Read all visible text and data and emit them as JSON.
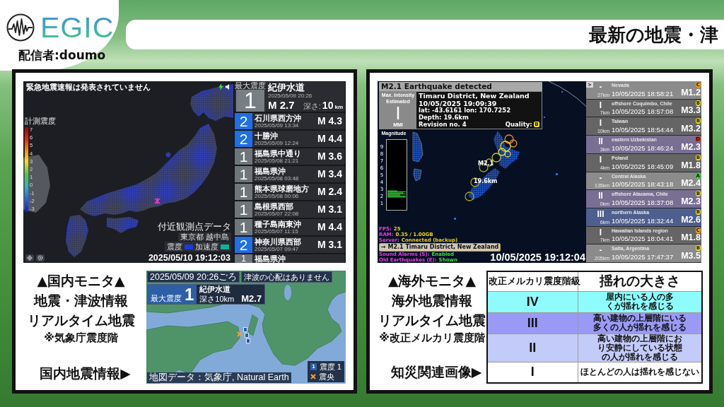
{
  "header": {
    "logo": "EGIC",
    "streamer": "配信者:doumo",
    "title": "最新の地震・津"
  },
  "domestic_panel": {
    "monitor": {
      "eew_status": "緊急地震速報は発表されていません",
      "intensity_scale": {
        "label": "計測震度",
        "ticks": [
          "7",
          "6",
          "5",
          "4",
          "3",
          "2",
          "1",
          "0",
          "-1",
          "-2",
          "-3"
        ]
      },
      "station": {
        "heading": "付近観測点データ",
        "name": "東京都 越中島",
        "legend": [
          {
            "label": "震度",
            "color": "#1a3ae0"
          },
          {
            "label": "加速度",
            "color": "#12b09a"
          }
        ]
      },
      "timestamp": "2025/05/10 19:12:03",
      "latest": {
        "label": "最大震度",
        "intensity": "1",
        "color": "#787f84",
        "place": "紀伊水道",
        "time": "2025/05/09 20:26",
        "magnitude": "M 2.7",
        "depth_label": "深さ:",
        "depth": "10",
        "depth_unit": "km"
      },
      "events": [
        {
          "intensity": "2",
          "color": "#1f6fe6",
          "place": "石川県西方沖",
          "time": "2025/05/09 13:34",
          "magnitude": "M 4.3"
        },
        {
          "intensity": "2",
          "color": "#1f6fe6",
          "place": "十勝沖",
          "time": "2025/05/09 12:24",
          "magnitude": "M 4.4"
        },
        {
          "intensity": "1",
          "color": "#6e767b",
          "place": "福島県中通り",
          "time": "2025/05/08 21:21",
          "magnitude": "M 3.6"
        },
        {
          "intensity": "1",
          "color": "#6e767b",
          "place": "福島県沖",
          "time": "2025/05/08 03:48",
          "magnitude": "M 3.4"
        },
        {
          "intensity": "1",
          "color": "#6e767b",
          "place": "熊本県球磨地方",
          "time": "2025/05/08 00:06",
          "magnitude": "M 2.4"
        },
        {
          "intensity": "1",
          "color": "#6e767b",
          "place": "島根県西部",
          "time": "2025/05/07 22:08",
          "magnitude": "M 3.1"
        },
        {
          "intensity": "1",
          "color": "#6e767b",
          "place": "種子島南東沖",
          "time": "2025/05/07 11:15",
          "magnitude": "M 4.4"
        },
        {
          "intensity": "2",
          "color": "#1f6fe6",
          "place": "神奈川県西部",
          "time": "2025/05/07 09:47",
          "magnitude": "M 3.1"
        },
        {
          "intensity": "1",
          "color": "#6e767b",
          "place": "福島県沖"
        }
      ]
    },
    "captions": [
      {
        "kind": "heading",
        "text": "▲国内モニタ▲"
      },
      {
        "kind": "heading",
        "text": "地震・津波情報"
      },
      {
        "kind": "heading",
        "text": "リアルタイム地震"
      },
      {
        "kind": "note",
        "text": "※気象庁震度階"
      }
    ],
    "pointer": "国内地震情報▶",
    "info_map": {
      "time": "2025/05/09 20:26ごろ",
      "tsunami": "津波の心配はありません",
      "label": "最大震度",
      "intensity": "1",
      "color": "#2d5fa6",
      "place": "紀伊水道",
      "depth": "深さ10km",
      "magnitude": "M2.7",
      "legend": [
        {
          "kind": "intensity",
          "mark": "1",
          "label": "震度 1",
          "color": "#2d5fa6"
        },
        {
          "kind": "epicenter",
          "label": "震央"
        }
      ],
      "attribution": "地図データ：気象庁, Natural Earth"
    }
  },
  "overseas_panel": {
    "monitor": {
      "alert": {
        "title": "M2.1 Earthquake detected",
        "intensity_label": "Max. Intensity",
        "intensity_note": "Estimated",
        "intensity": "I",
        "scale": "MMI",
        "place": "Timaru District, New Zealand",
        "time": "10/05/2025 19:09:39",
        "coordinates": "lat: -43.6161 lon: 170.7252",
        "depth": "Depth: 19.6km",
        "revision": "Revision no. 4",
        "quality_label": "Quality:",
        "quality": {
          "grade": "B",
          "color": "#f2e41c"
        }
      },
      "magnitude_meter": {
        "label": "Magnitude",
        "ticks": [
          "9",
          "8",
          "7",
          "6",
          "5",
          "4",
          "3",
          "2",
          "1"
        ]
      },
      "map_labels": {
        "magnitude": "M2.1",
        "depth": "19.6km"
      },
      "status": [
        {
          "label": "FPS:",
          "value": "25",
          "color": "#e8d41c"
        },
        {
          "label": "RAM:",
          "value": "0.35 / 1.00GB",
          "color": "#e8d41c"
        },
        {
          "label": "Server:",
          "value": "Connected (backup)",
          "color": "#e8d41c"
        }
      ],
      "selected_event": "→ M2.1 Timaru District, New Zealand",
      "toggles": [
        {
          "label": "Sound Alarms (S):",
          "value": "Enabled",
          "color": "#3ce03c"
        },
        {
          "label": "Old Earthquakes (E):",
          "value": "Shown",
          "color": "#3ce03c"
        }
      ],
      "timestamp": "10/05/2025 19:12:04",
      "list_toggle": ">",
      "events": [
        {
          "intensity": "-",
          "depth": "27km",
          "place": "Nevada",
          "time": "10/05/2025 18:58:21",
          "magnitude": "M1.2",
          "color": "#8b8b8b",
          "quality": {
            "grade": "C",
            "color": "#f0a01c"
          }
        },
        {
          "intensity": "I",
          "depth": "7km",
          "place": "offshore Coquimbo, Chile",
          "time": "10/05/2025 18:57:08",
          "magnitude": "M3.3",
          "color": "#656565",
          "quality": {
            "grade": "B",
            "color": "#f2e41c"
          }
        },
        {
          "intensity": "I",
          "depth": "10km",
          "place": "Taiwan",
          "time": "10/05/2025 18:54:44",
          "magnitude": "M3.2",
          "color": "#656565",
          "quality": {
            "grade": "B",
            "color": "#f2e41c"
          }
        },
        {
          "intensity": "II",
          "depth": "3km",
          "place": "eastern Uzbekistan",
          "time": "10/05/2025 18:46:24",
          "magnitude": "M2.3",
          "color": "#786f92",
          "quality": {
            "grade": "D",
            "color": "#e0361c"
          }
        },
        {
          "intensity": "I",
          "depth": "4km",
          "place": "Poland",
          "time": "10/05/2025 18:45:09",
          "magnitude": "M1.8",
          "color": "#656565",
          "quality": {
            "grade": "B",
            "color": "#f2e41c"
          }
        },
        {
          "intensity": "-",
          "depth": "135km",
          "place": "Central Alaska",
          "time": "10/05/2025 18:43:18",
          "magnitude": "M2.4",
          "color": "#8b8b8b",
          "quality": {
            "grade": "A",
            "color": "#2ee02e"
          }
        },
        {
          "intensity": "II",
          "depth": "0km",
          "place": "offshore Atacama, Chile",
          "time": "10/05/2025 18:37:08",
          "magnitude": "M2.3",
          "color": "#786f92",
          "quality": {
            "grade": "B",
            "color": "#f2e41c"
          }
        },
        {
          "intensity": "III",
          "depth": "6km",
          "place": "northern Alaska",
          "time": "10/05/2025 18:32:44",
          "magnitude": "M2.6",
          "color": "#4e5e8e",
          "quality": {
            "grade": "B",
            "color": "#f2e41c"
          }
        },
        {
          "intensity": "I",
          "depth": "7km",
          "place": "Hawaiian Islands region",
          "time": "10/05/2025 18:04:41",
          "magnitude": "M1.8",
          "color": "#656565",
          "quality": {
            "grade": "C",
            "color": "#f0a01c"
          }
        },
        {
          "intensity": "-",
          "depth": "205km",
          "place": "Salta, Argentina",
          "time": "10/05/2025 17:47:37",
          "magnitude": "M3.5",
          "color": "#8b8b8b",
          "quality": {
            "grade": "B",
            "color": "#f2e41c"
          }
        }
      ]
    },
    "captions": [
      {
        "kind": "heading",
        "text": "▲海外モニタ▲"
      },
      {
        "kind": "heading",
        "text": "海外地震情報"
      },
      {
        "kind": "heading",
        "text": "リアルタイム地震"
      },
      {
        "kind": "note",
        "text": "※改正メルカリ震度階"
      }
    ],
    "pointer": "知災関連画像▶",
    "mmi_table": {
      "columns": [
        "改正メルカリ震度階級",
        "揺れの大きさ"
      ],
      "rows": [
        {
          "grade": "IV",
          "description": "屋内にいる人の多くが揺れを感じる",
          "color": "#8efcfc"
        },
        {
          "grade": "III",
          "description": "高い建物の上層階にいる多くの人が揺れを感じる",
          "color": "#9a9af6"
        },
        {
          "grade": "II",
          "description": "高い建物の上層階におり安静にしている状態の人が揺れを感じる",
          "color": "#c3cbf9"
        },
        {
          "grade": "I",
          "description": "ほとんどの人は揺れを感じない",
          "color": "#ffffff"
        }
      ]
    }
  }
}
